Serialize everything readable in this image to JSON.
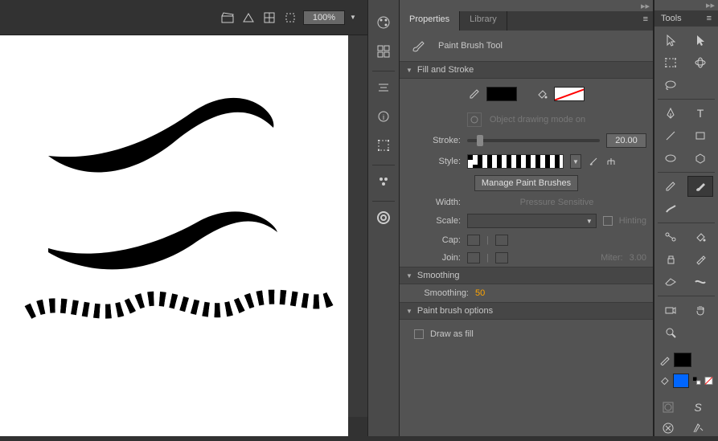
{
  "toolbar": {
    "zoom": "100%"
  },
  "tabs": {
    "properties": "Properties",
    "library": "Library"
  },
  "tool_title": "Paint Brush Tool",
  "sections": {
    "fill_stroke": "Fill and Stroke",
    "smoothing": "Smoothing",
    "paint_brush_options": "Paint brush options"
  },
  "labels": {
    "object_drawing": "Object drawing mode on",
    "stroke": "Stroke:",
    "style": "Style:",
    "manage_brushes": "Manage Paint Brushes",
    "width": "Width:",
    "pressure": "Pressure Sensitive",
    "scale": "Scale:",
    "hinting": "Hinting",
    "cap": "Cap:",
    "join": "Join:",
    "miter": "Miter:",
    "smoothing": "Smoothing:",
    "draw_as_fill": "Draw as fill"
  },
  "values": {
    "stroke": "20.00",
    "miter": "3.00",
    "smoothing": "50"
  },
  "tools_title": "Tools"
}
